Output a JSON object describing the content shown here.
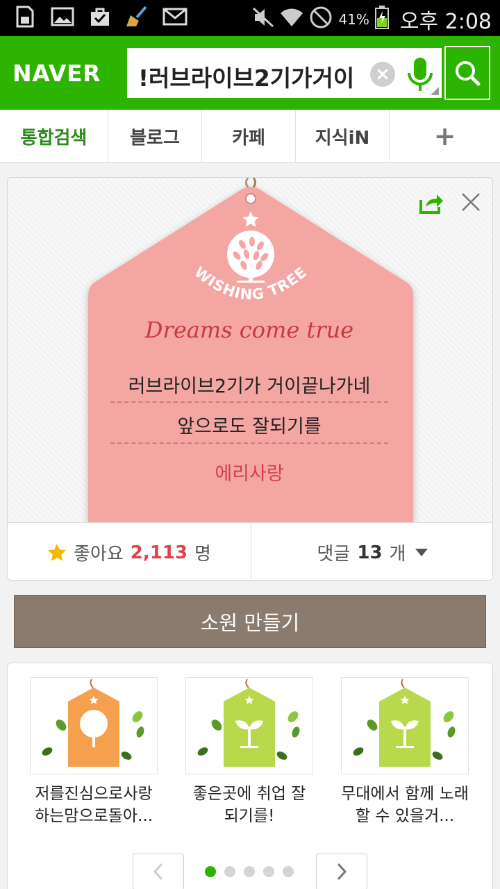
{
  "status_bar": {
    "icons": [
      "sd-card-icon",
      "image-icon",
      "checkbox-bag-icon",
      "broom-icon",
      "mail-icon"
    ],
    "right_icons": [
      "mute-icon",
      "wifi-icon",
      "no-sim-icon",
      "battery-icon"
    ],
    "battery": "41%",
    "time": "오후 2:08"
  },
  "header": {
    "logo": "NAVER",
    "query": "!러브라이브2기가거이",
    "clear_icon": "clear-icon",
    "mic_icon": "microphone-icon",
    "search_icon": "search-icon",
    "brand_color": "#2db400"
  },
  "tabs": [
    {
      "label": "통합검색",
      "active": true
    },
    {
      "label": "블로그",
      "active": false
    },
    {
      "label": "카페",
      "active": false
    },
    {
      "label": "지식iN",
      "active": false
    },
    {
      "label": "+",
      "active": false
    }
  ],
  "wish": {
    "badge_text": "WISHING TREE",
    "dreams_text": "Dreams come true",
    "lines": [
      "러브라이브2기가 거이끝나가네",
      "앞으로도 잘되기를"
    ],
    "author": "에리사랑",
    "tag_color": "#f4a6a3",
    "like_label": "좋아요",
    "like_count": "2,113",
    "like_unit": "명",
    "comment_label": "댓글",
    "comment_count": "13",
    "comment_unit": "개"
  },
  "make_button": "소원 만들기",
  "related": [
    {
      "text": "저를진심으로사랑하는맘으로돌아...",
      "tag_color": "#f4a04e",
      "motif": "tree"
    },
    {
      "text": "좋은곳에 취업 잘 되기를!",
      "tag_color": "#b9d94c",
      "motif": "sprout"
    },
    {
      "text": "무대에서 함께 노래 할 수 있을거...",
      "tag_color": "#b9d94c",
      "motif": "sprout"
    }
  ],
  "pager": {
    "pages": 5,
    "current": 1
  }
}
